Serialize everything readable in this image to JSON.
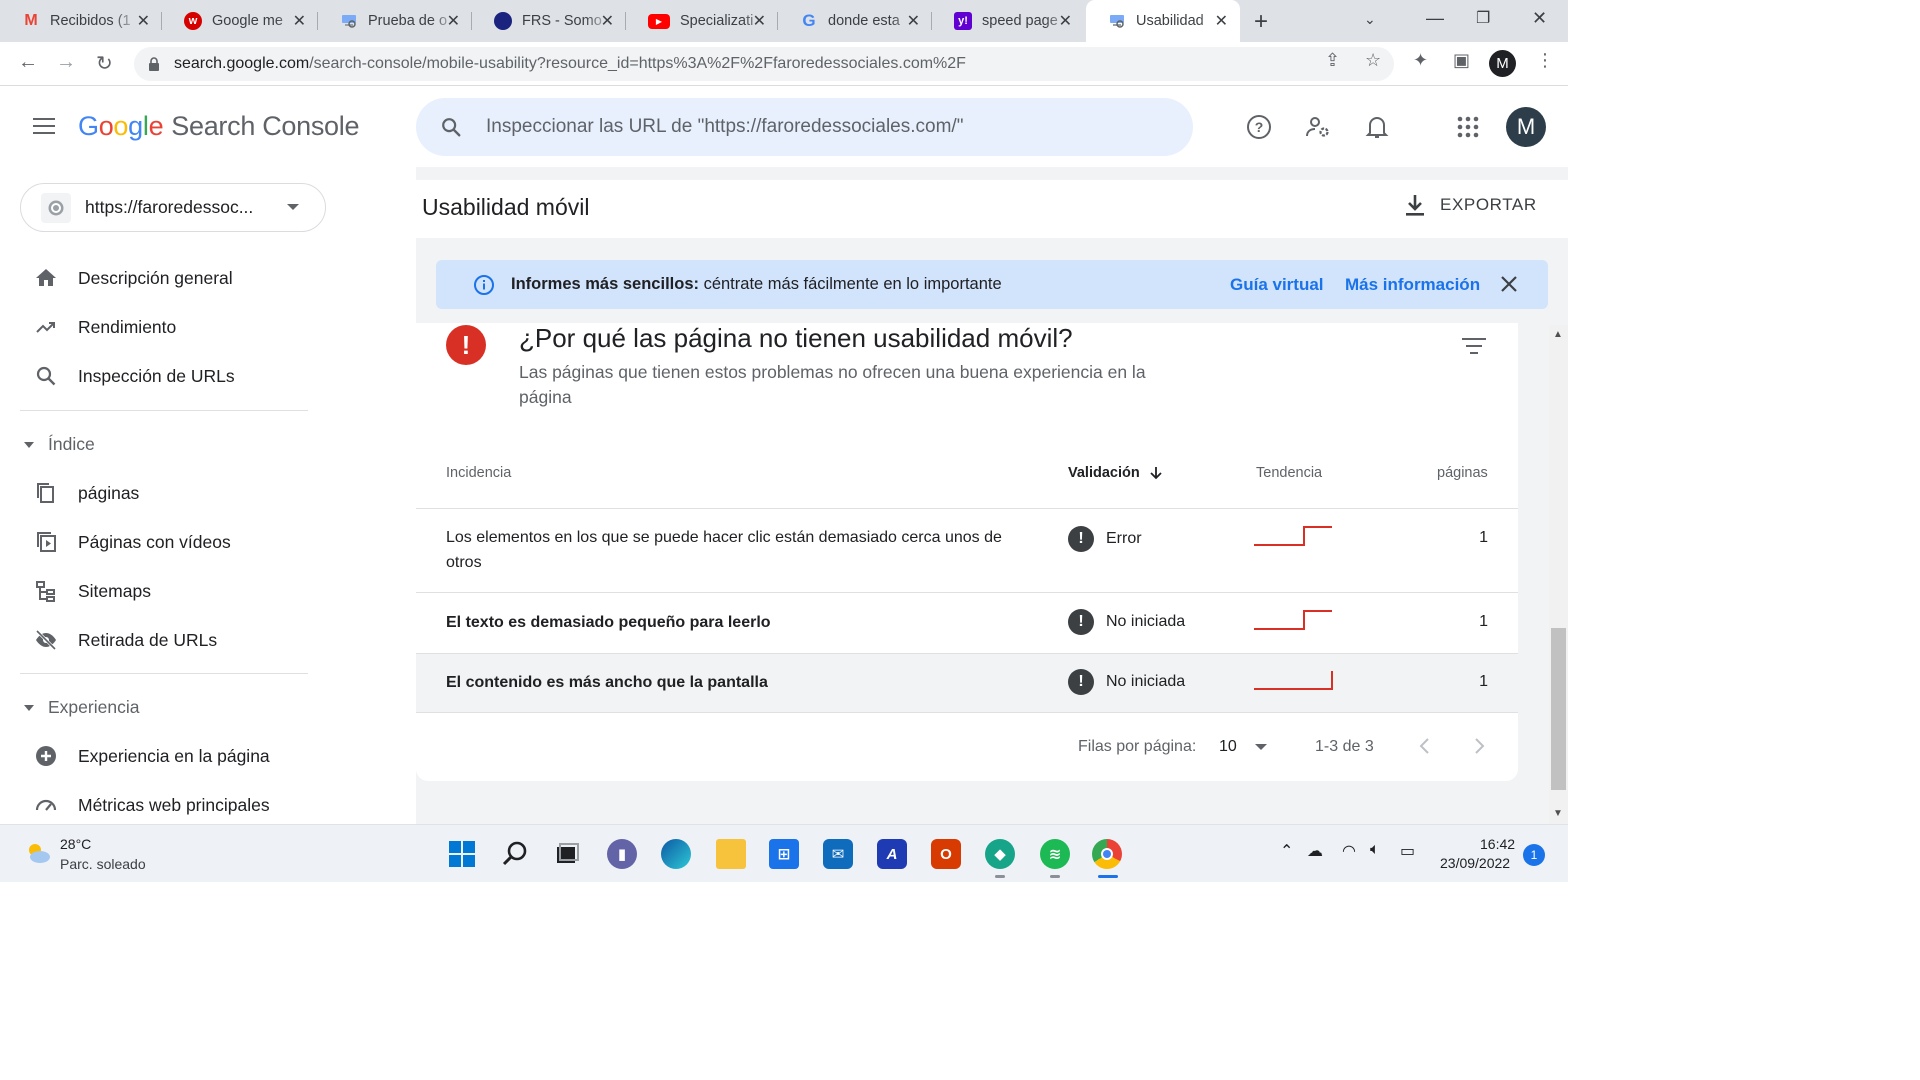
{
  "browser": {
    "tabs": [
      {
        "title": "Recibidos (1",
        "favicon": "gmail-icon",
        "color": "#ea4335",
        "glyph": "M"
      },
      {
        "title": "Google me",
        "favicon": "w-icon",
        "color": "#d50000",
        "glyph": "w"
      },
      {
        "title": "Prueba de o",
        "favicon": "search-console-icon",
        "color": "#7baaf7",
        "glyph": ""
      },
      {
        "title": "FRS - Somo",
        "favicon": "frs-icon",
        "color": "#1a237e",
        "glyph": ""
      },
      {
        "title": "Specializati",
        "favicon": "youtube-icon",
        "color": "#ff0000",
        "glyph": "▶"
      },
      {
        "title": "donde esta",
        "favicon": "google-icon",
        "color": "#ffffff",
        "glyph": "G"
      },
      {
        "title": "speed page",
        "favicon": "yahoo-icon",
        "color": "#6001d2",
        "glyph": "y!"
      },
      {
        "title": "Usabilidad",
        "favicon": "search-console-icon",
        "color": "#7baaf7",
        "glyph": "",
        "active": true
      }
    ],
    "url_host": "search.google.com",
    "url_path": "/search-console/mobile-usability?resource_id=https%3A%2F%2Ffaroredessociales.com%2F",
    "profile_initial": "M"
  },
  "header": {
    "logo_letters": [
      "G",
      "o",
      "o",
      "g",
      "l",
      "e"
    ],
    "product": "Search Console",
    "search_placeholder": "Inspeccionar las URL de \"https://faroredessociales.com/\"",
    "avatar_initial": "M"
  },
  "sidebar": {
    "property": "https://faroredessoc...",
    "items": [
      {
        "label": "Descripción general",
        "icon": "home-icon"
      },
      {
        "label": "Rendimiento",
        "icon": "trending-up-icon"
      },
      {
        "label": "Inspección de URLs",
        "icon": "search-icon"
      }
    ],
    "section_index": "Índice",
    "index_items": [
      {
        "label": "páginas",
        "icon": "pages-icon"
      },
      {
        "label": "Páginas con vídeos",
        "icon": "video-pages-icon"
      },
      {
        "label": "Sitemaps",
        "icon": "sitemap-icon"
      },
      {
        "label": "Retirada de URLs",
        "icon": "eye-off-icon"
      }
    ],
    "section_experience": "Experiencia",
    "experience_items": [
      {
        "label": "Experiencia en la página",
        "icon": "page-experience-icon"
      },
      {
        "label": "Métricas web principales",
        "icon": "speed-icon"
      }
    ]
  },
  "main": {
    "title": "Usabilidad móvil",
    "export_label": "EXPORTAR",
    "banner": {
      "bold": "Informes más sencillos:",
      "text": " céntrate más fácilmente en lo importante",
      "link1": "Guía virtual",
      "link2": "Más información"
    },
    "card": {
      "title": "¿Por qué las página no tienen usabilidad móvil?",
      "subtitle": "Las páginas que tienen estos problemas no ofrecen una buena experiencia en la página",
      "columns": {
        "issue": "Incidencia",
        "validation": "Validación",
        "trend": "Tendencia",
        "pages": "páginas"
      },
      "rows": [
        {
          "issue": "Los elementos en los que se puede hacer clic están demasiado cerca unos de otros",
          "validation": "Error",
          "pages": "1",
          "trend": "step-up"
        },
        {
          "issue": "El texto es demasiado pequeño para leerlo",
          "validation": "No iniciada",
          "pages": "1",
          "trend": "step-up"
        },
        {
          "issue": "El contenido es más ancho que la pantalla",
          "validation": "No iniciada",
          "pages": "1",
          "trend": "step-up-late"
        }
      ],
      "pager": {
        "rows_label": "Filas por página:",
        "rows_value": "10",
        "range": "1-3 de 3"
      }
    }
  },
  "taskbar": {
    "weather_temp": "28°C",
    "weather_desc": "Parc. soleado",
    "time": "16:42",
    "date": "23/09/2022",
    "notifications": "1"
  }
}
